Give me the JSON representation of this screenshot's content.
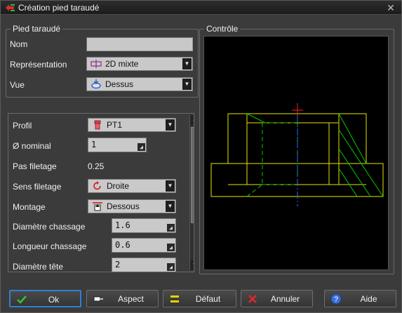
{
  "window": {
    "title": "Création pied taraudé",
    "close_glyph": "✕"
  },
  "group_pied": {
    "legend": "Pied taraudé",
    "nom_label": "Nom",
    "nom_value": "",
    "representation_label": "Représentation",
    "representation_value": "2D mixte",
    "representation_icon": "representation-2d-icon",
    "vue_label": "Vue",
    "vue_value": "Dessus",
    "vue_icon": "view-top-icon"
  },
  "params": {
    "profil_label": "Profil",
    "profil_value": "PT1",
    "profil_icon": "profile-pt1-icon",
    "nominal_label": "Ø nominal",
    "nominal_value": "1",
    "pas_label": "Pas filetage",
    "pas_value": "0.25",
    "sens_label": "Sens filetage",
    "sens_value": "Droite",
    "sens_icon": "rotate-right-icon",
    "montage_label": "Montage",
    "montage_value": "Dessous",
    "montage_icon": "mount-below-icon",
    "diam_chassage_label": "Diamètre chassage",
    "diam_chassage_value": "1.6",
    "long_chassage_label": "Longueur chassage",
    "long_chassage_value": "0.6",
    "diam_tete_label": "Diamètre tête",
    "diam_tete_value": "2"
  },
  "group_controle": {
    "legend": "Contrôle"
  },
  "buttons": {
    "ok": "Ok",
    "aspect": "Aspect",
    "defaut": "Défaut",
    "annuler": "Annuler",
    "aide": "Aide"
  },
  "colors": {
    "outline": "#e6e600",
    "hidden": "#00cc00",
    "axis": "#3366ff",
    "cross": "#ff2020",
    "primary_border": "#2f7fd4"
  }
}
